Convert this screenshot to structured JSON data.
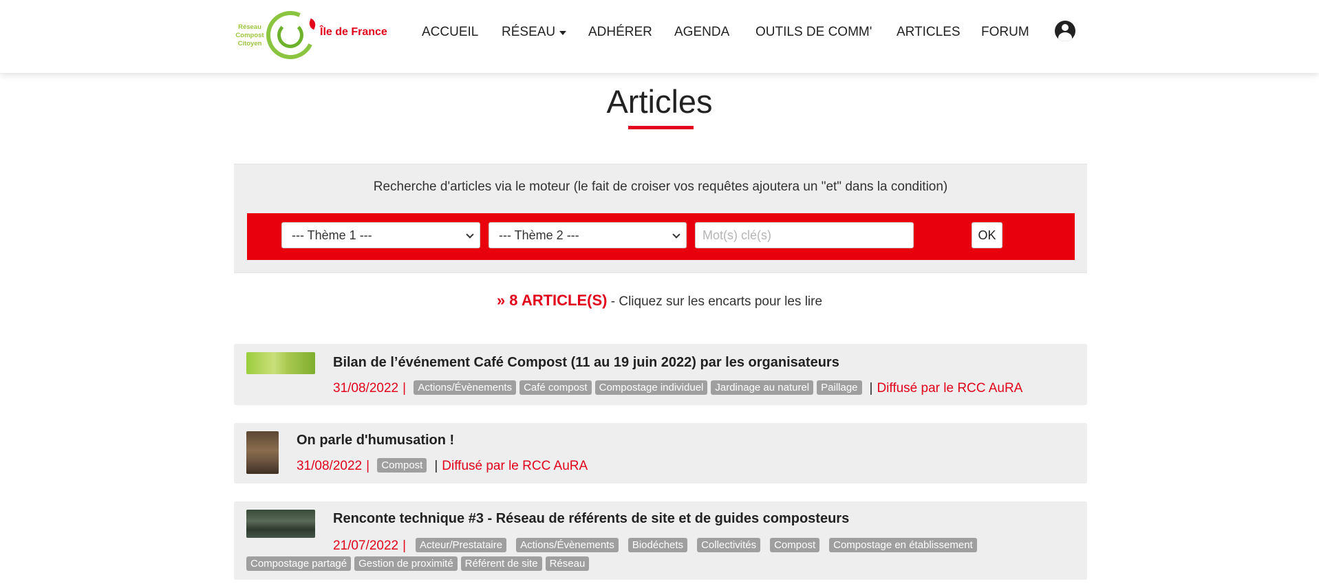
{
  "header": {
    "logo": {
      "small_text": "Réseau Compost Citoyen",
      "mark": "rcc",
      "region": "Île de France"
    },
    "nav": [
      {
        "label": "ACCUEIL"
      },
      {
        "label": "RÉSEAU",
        "has_dropdown": true
      },
      {
        "label": "ADHÉRER"
      },
      {
        "label": "AGENDA"
      },
      {
        "label": "OUTILS DE COMM'"
      },
      {
        "label": "ARTICLES"
      },
      {
        "label": "FORUM"
      }
    ],
    "user_icon": "user-circle-icon"
  },
  "page": {
    "title": "Articles"
  },
  "search": {
    "description": "Recherche d'articles via le moteur (le fait de croiser vos requêtes ajoutera un \"et\" dans la condition)",
    "theme1": "--- Thème 1 ---",
    "theme2": "--- Thème 2 ---",
    "keyword_placeholder": "Mot(s) clé(s)",
    "keyword_value": "",
    "ok_label": "OK"
  },
  "results": {
    "count_label": "» 8 ARTICLE(S)",
    "hint": "- Cliquez sur les encarts pour les lire"
  },
  "articles": [
    {
      "title": "Bilan de l’événement Café Compost (11 au 19 juin 2022) par les organisateurs",
      "date": "31/08/2022",
      "tags": [
        "Actions/Évènements",
        "Café compost",
        "Compostage individuel",
        "Jardinage au naturel",
        "Paillage"
      ],
      "source": "Diffusé par le RCC AuRA"
    },
    {
      "title": "On parle d'humusation !",
      "date": "31/08/2022",
      "tags": [
        "Compost"
      ],
      "source": "Diffusé par le RCC AuRA"
    },
    {
      "title": "Renconte technique #3 - Réseau de référents de site et de guides composteurs",
      "date": "21/07/2022",
      "tags": [
        "Acteur/Prestataire",
        "Actions/Évènements",
        "Biodéchets",
        "Collectivités",
        "Compost",
        "Compostage en établissement",
        "Compostage partagé",
        "Gestion de proximité",
        "Référent de site",
        "Réseau"
      ],
      "source": ""
    }
  ],
  "colors": {
    "accent": "#e2001a",
    "logo_green": "#8bc53f",
    "panel_bg": "#eeeeee",
    "tag_bg": "#9f9f9f"
  }
}
